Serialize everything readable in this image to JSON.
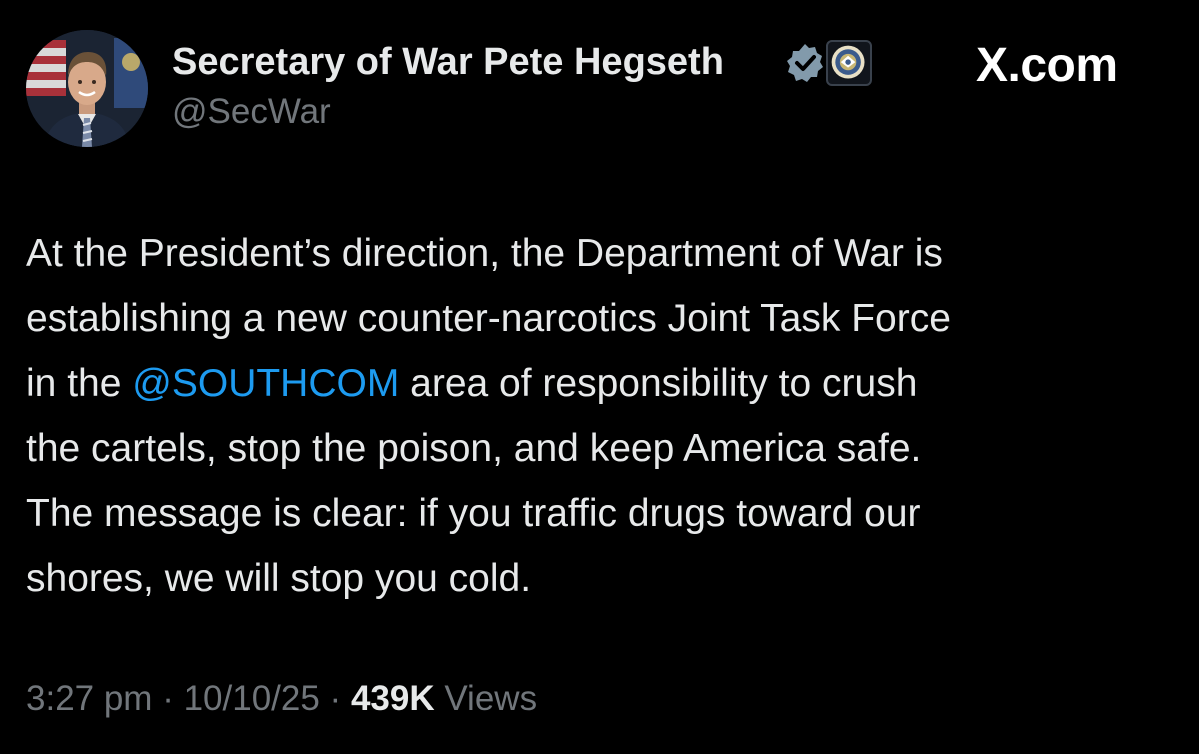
{
  "author": {
    "display_name": "Secretary of War Pete Hegseth",
    "handle": "@SecWar",
    "avatar_icon": "profile-photo",
    "verified_icon": "verified-check-icon",
    "affiliate_icon": "department-seal-icon",
    "verified_color": "#829aab"
  },
  "brand": {
    "name": "X.com"
  },
  "tweet": {
    "lines": [
      {
        "before": "At the President’s direction, the Department of War is"
      },
      {
        "before": "establishing a new counter-narcotics Joint Task Force"
      },
      {
        "before": "in the ",
        "mention": "@SOUTHCOM",
        "after": " area of responsibility to crush"
      },
      {
        "before": "the cartels, stop the poison, and keep America safe."
      },
      {
        "before": "The message is clear: if you traffic drugs toward our"
      },
      {
        "before": "shores, we will stop you cold."
      }
    ],
    "mention_color": "#1d9bf0"
  },
  "meta": {
    "time": "3:27 pm",
    "separator": " · ",
    "date": "10/10/25",
    "views_count": "439K",
    "views_label": " Views"
  },
  "colors": {
    "background": "#000000",
    "primary_text": "#e7e9ea",
    "secondary_text": "#71767b",
    "link": "#1d9bf0"
  }
}
